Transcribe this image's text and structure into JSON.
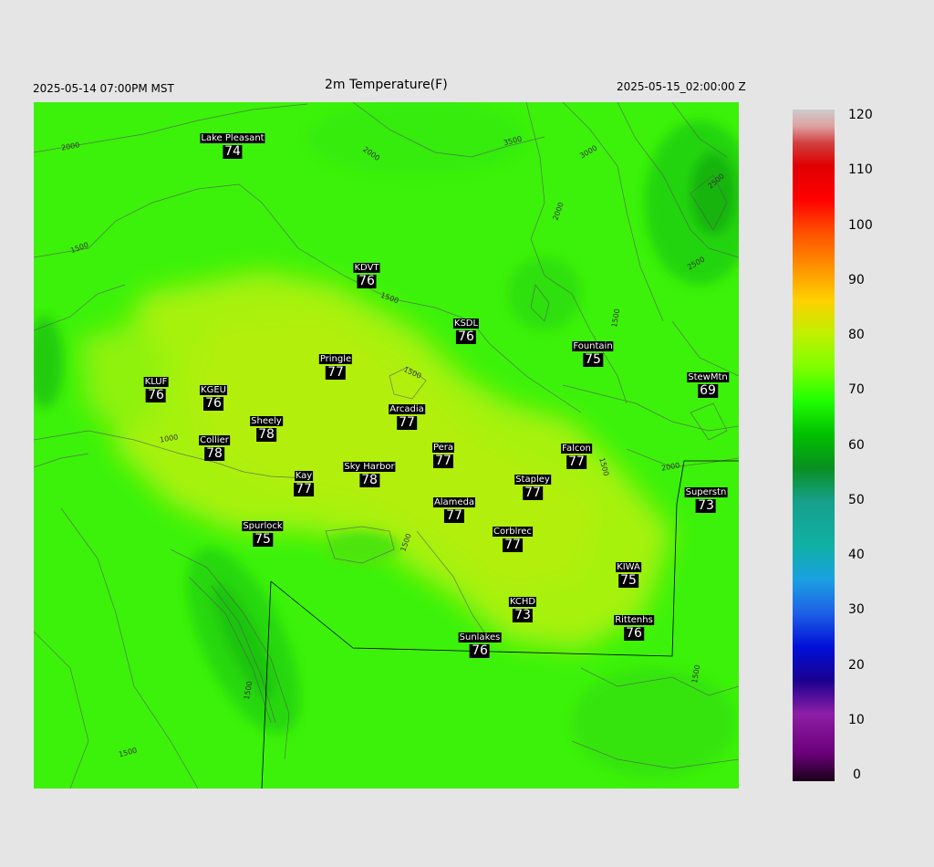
{
  "header": {
    "left": "2025-05-14 07:00PM MST",
    "title": "2m Temperature(F)",
    "right": "2025-05-15_02:00:00 Z"
  },
  "colorbar": {
    "ticks": [
      "120",
      "110",
      "100",
      "90",
      "80",
      "70",
      "60",
      "50",
      "40",
      "30",
      "20",
      "10",
      "0"
    ],
    "stops": [
      {
        "v": 0,
        "c": "#1a0018"
      },
      {
        "v": 5,
        "c": "#6a007a"
      },
      {
        "v": 12,
        "c": "#8e1ea6"
      },
      {
        "v": 18,
        "c": "#1a0090"
      },
      {
        "v": 24,
        "c": "#0010d8"
      },
      {
        "v": 30,
        "c": "#1e60e6"
      },
      {
        "v": 36,
        "c": "#1aa0e0"
      },
      {
        "v": 42,
        "c": "#10b0a6"
      },
      {
        "v": 50,
        "c": "#17a08a"
      },
      {
        "v": 56,
        "c": "#089020"
      },
      {
        "v": 62,
        "c": "#00c000"
      },
      {
        "v": 68,
        "c": "#20ff00"
      },
      {
        "v": 74,
        "c": "#80ff00"
      },
      {
        "v": 80,
        "c": "#c0f000"
      },
      {
        "v": 86,
        "c": "#ffd000"
      },
      {
        "v": 92,
        "c": "#ff9000"
      },
      {
        "v": 98,
        "c": "#ff5000"
      },
      {
        "v": 104,
        "c": "#ff0000"
      },
      {
        "v": 110,
        "c": "#e00000"
      },
      {
        "v": 114,
        "c": "#d04040"
      },
      {
        "v": 117,
        "c": "#e0a0a0"
      },
      {
        "v": 120,
        "c": "#cccccc"
      }
    ]
  },
  "contour_labels": [
    "2000",
    "2000",
    "1500",
    "1500",
    "1500",
    "1500",
    "1500",
    "1000",
    "2000",
    "2000",
    "2500",
    "3000",
    "3500",
    "2500",
    "1500",
    "1500",
    "1500",
    "1500"
  ],
  "stations": [
    {
      "name": "Lake Pleasant",
      "value": "74"
    },
    {
      "name": "KDVT",
      "value": "76"
    },
    {
      "name": "KSDL",
      "value": "76"
    },
    {
      "name": "Fountain",
      "value": "75"
    },
    {
      "name": "StewMtn",
      "value": "69"
    },
    {
      "name": "Pringle",
      "value": "77"
    },
    {
      "name": "KLUF",
      "value": "76"
    },
    {
      "name": "KGEU",
      "value": "76"
    },
    {
      "name": "Arcadia",
      "value": "77"
    },
    {
      "name": "Sheely",
      "value": "78"
    },
    {
      "name": "Collier",
      "value": "78"
    },
    {
      "name": "Pera",
      "value": "77"
    },
    {
      "name": "Falcon",
      "value": "77"
    },
    {
      "name": "Sky Harbor",
      "value": "78"
    },
    {
      "name": "Kay",
      "value": "77"
    },
    {
      "name": "Stapley",
      "value": "77"
    },
    {
      "name": "Superstn",
      "value": "73"
    },
    {
      "name": "Alameda",
      "value": "77"
    },
    {
      "name": "Spurlock",
      "value": "75"
    },
    {
      "name": "Corblrec",
      "value": "77"
    },
    {
      "name": "KIWA",
      "value": "75"
    },
    {
      "name": "KCHD",
      "value": "73"
    },
    {
      "name": "Rittenhs",
      "value": "76"
    },
    {
      "name": "Sunlakes",
      "value": "76"
    }
  ]
}
